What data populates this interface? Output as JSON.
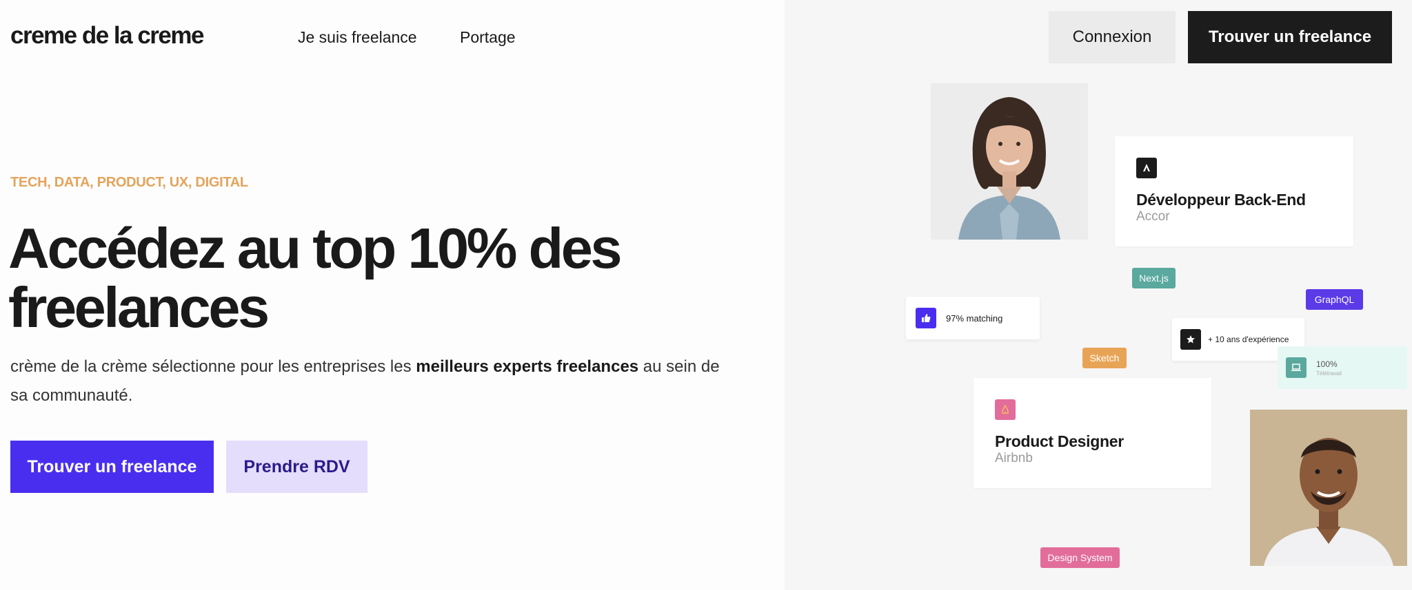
{
  "header": {
    "logo": "creme de la creme",
    "nav": [
      "Je suis freelance",
      "Portage"
    ],
    "login_label": "Connexion",
    "find_label": "Trouver un freelance"
  },
  "hero": {
    "eyebrow": "TECH, DATA, PRODUCT, UX, DIGITAL",
    "headline_line1": "Accédez au top 10% des",
    "headline_line2": "freelances",
    "sub_part1": "crème de la crème sélectionne pour les entreprises les ",
    "sub_bold": "meilleurs experts freelances",
    "sub_part2": " au sein de sa communauté.",
    "cta_primary": "Trouver un freelance",
    "cta_secondary": "Prendre RDV"
  },
  "cards": {
    "backend": {
      "title": "Développeur Back-End",
      "company": "Accor"
    },
    "designer": {
      "title": "Product Designer",
      "company": "Airbnb"
    }
  },
  "tags": {
    "nextjs": "Next.js",
    "graphql": "GraphQL",
    "sketch": "Sketch",
    "design_system": "Design System"
  },
  "pills": {
    "matching": "97% matching",
    "experience": "+ 10 ans d'expérience",
    "remote_value": "100%",
    "remote_label": "Télétravail"
  },
  "colors": {
    "accent": "#4a2ef0",
    "accent_light": "#e4ddfb",
    "eyebrow": "#e5a35b",
    "nextjs": "#5aa89e",
    "graphql": "#5b3ae8",
    "sketch": "#e8a456",
    "design_system": "#e26d9a"
  }
}
